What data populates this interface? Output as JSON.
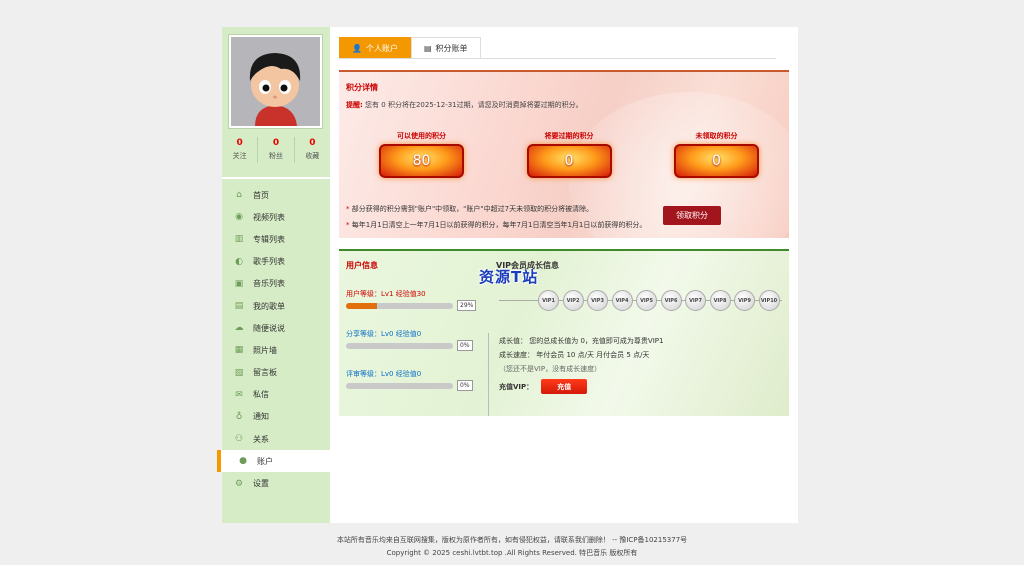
{
  "sidebar": {
    "stats": [
      {
        "value": "0",
        "label": "关注"
      },
      {
        "value": "0",
        "label": "粉丝"
      },
      {
        "value": "0",
        "label": "收藏"
      }
    ],
    "nav": [
      {
        "label": "首页",
        "icon": "home-icon"
      },
      {
        "label": "视频列表",
        "icon": "eye-icon"
      },
      {
        "label": "专辑列表",
        "icon": "album-icon"
      },
      {
        "label": "歌手列表",
        "icon": "singer-icon"
      },
      {
        "label": "音乐列表",
        "icon": "music-icon"
      },
      {
        "label": "我的歌单",
        "icon": "playlist-icon"
      },
      {
        "label": "随便说说",
        "icon": "chat-icon"
      },
      {
        "label": "照片墙",
        "icon": "photo-icon"
      },
      {
        "label": "留言板",
        "icon": "message-board-icon"
      },
      {
        "label": "私信",
        "icon": "mail-icon"
      },
      {
        "label": "通知",
        "icon": "bell-icon"
      },
      {
        "label": "关系",
        "icon": "relation-icon"
      },
      {
        "label": "账户",
        "icon": "user-icon"
      },
      {
        "label": "设置",
        "icon": "gear-icon"
      }
    ],
    "active_index": 12
  },
  "tabs": {
    "personal": "个人账户",
    "points": "积分账单"
  },
  "points": {
    "title": "积分详情",
    "notice_prefix": "提醒:",
    "notice_body": "您有 0 积分将在2025-12-31过期，请您及时消费掉将要过期的积分。",
    "badges": [
      {
        "label": "可以使用的积分",
        "value": "80"
      },
      {
        "label": "将要过期的积分",
        "value": "0"
      },
      {
        "label": "未领取的积分",
        "value": "0"
      }
    ],
    "rule1": "部分获得的积分需到\"账户\"中领取，\"账户\"中超过7天未领取的积分将被清除。",
    "rule2": "每年1月1日清空上一年7月1日以前获得的积分，每年7月1日清空当年1月1日以前获得的积分。",
    "claim_button": "领取积分"
  },
  "user": {
    "title": "用户信息",
    "levels": [
      {
        "text": "用户等级：Lv1    经验值30",
        "pct": "29%",
        "fill": 29
      },
      {
        "text": "分享等级：Lv0    经验值0",
        "pct": "0%",
        "fill": 0
      },
      {
        "text": "评审等级：Lv0    经验值0",
        "pct": "0%",
        "fill": 0
      }
    ],
    "vip_title": "VIP会员成长信息",
    "watermark": "资源T站",
    "vip_levels": [
      "VIP1",
      "VIP2",
      "VIP3",
      "VIP4",
      "VIP5",
      "VIP6",
      "VIP7",
      "VIP8",
      "VIP9",
      "VIP10"
    ],
    "growth_value": "成长值：  您的总成长值为 0，充值即可成为尊贵VIP1",
    "growth_speed": "成长速度：  年付会员    10 点/天      月付会员    5 点/天",
    "growth_note": "（您还不是VIP，没有成长速度）",
    "recharge_label": "充值VIP：",
    "recharge_button": "充值"
  },
  "footer": {
    "line1": "本站所有音乐均来自互联网搜集，版权为原作者所有，如有侵犯权益，请联系我们删除！ -- 豫ICP备10215377号",
    "line2": "Copyright © 2025 ceshi.lvtbt.top .All Rights Reserved. 特巴音乐 版权所有"
  },
  "colors": {
    "accent": "#f39800",
    "sidebar_bg": "#d6ecc6",
    "points_border": "#c85a2e",
    "user_border": "#3f8b2a",
    "claim_button": "#a3151c"
  }
}
